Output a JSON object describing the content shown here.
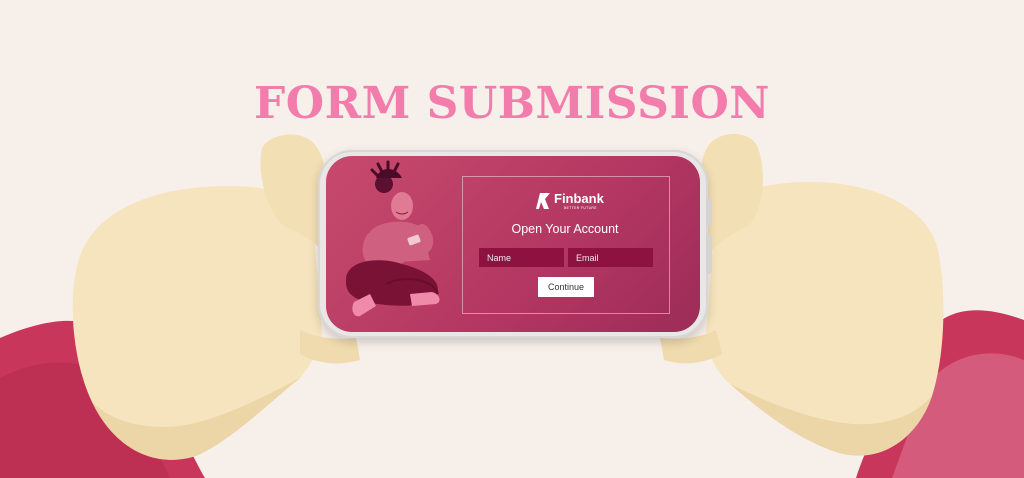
{
  "headline": "FORM SUBMISSION",
  "brand": {
    "name": "Finbank",
    "tagline": "BETTER FUTURE"
  },
  "form": {
    "title": "Open Your Account",
    "name_placeholder": "Name",
    "email_placeholder": "Email",
    "continue_label": "Continue"
  },
  "colors": {
    "background": "#f7efea",
    "headline": "#f27cab",
    "screen": "#b53863",
    "field": "#8e1240"
  }
}
